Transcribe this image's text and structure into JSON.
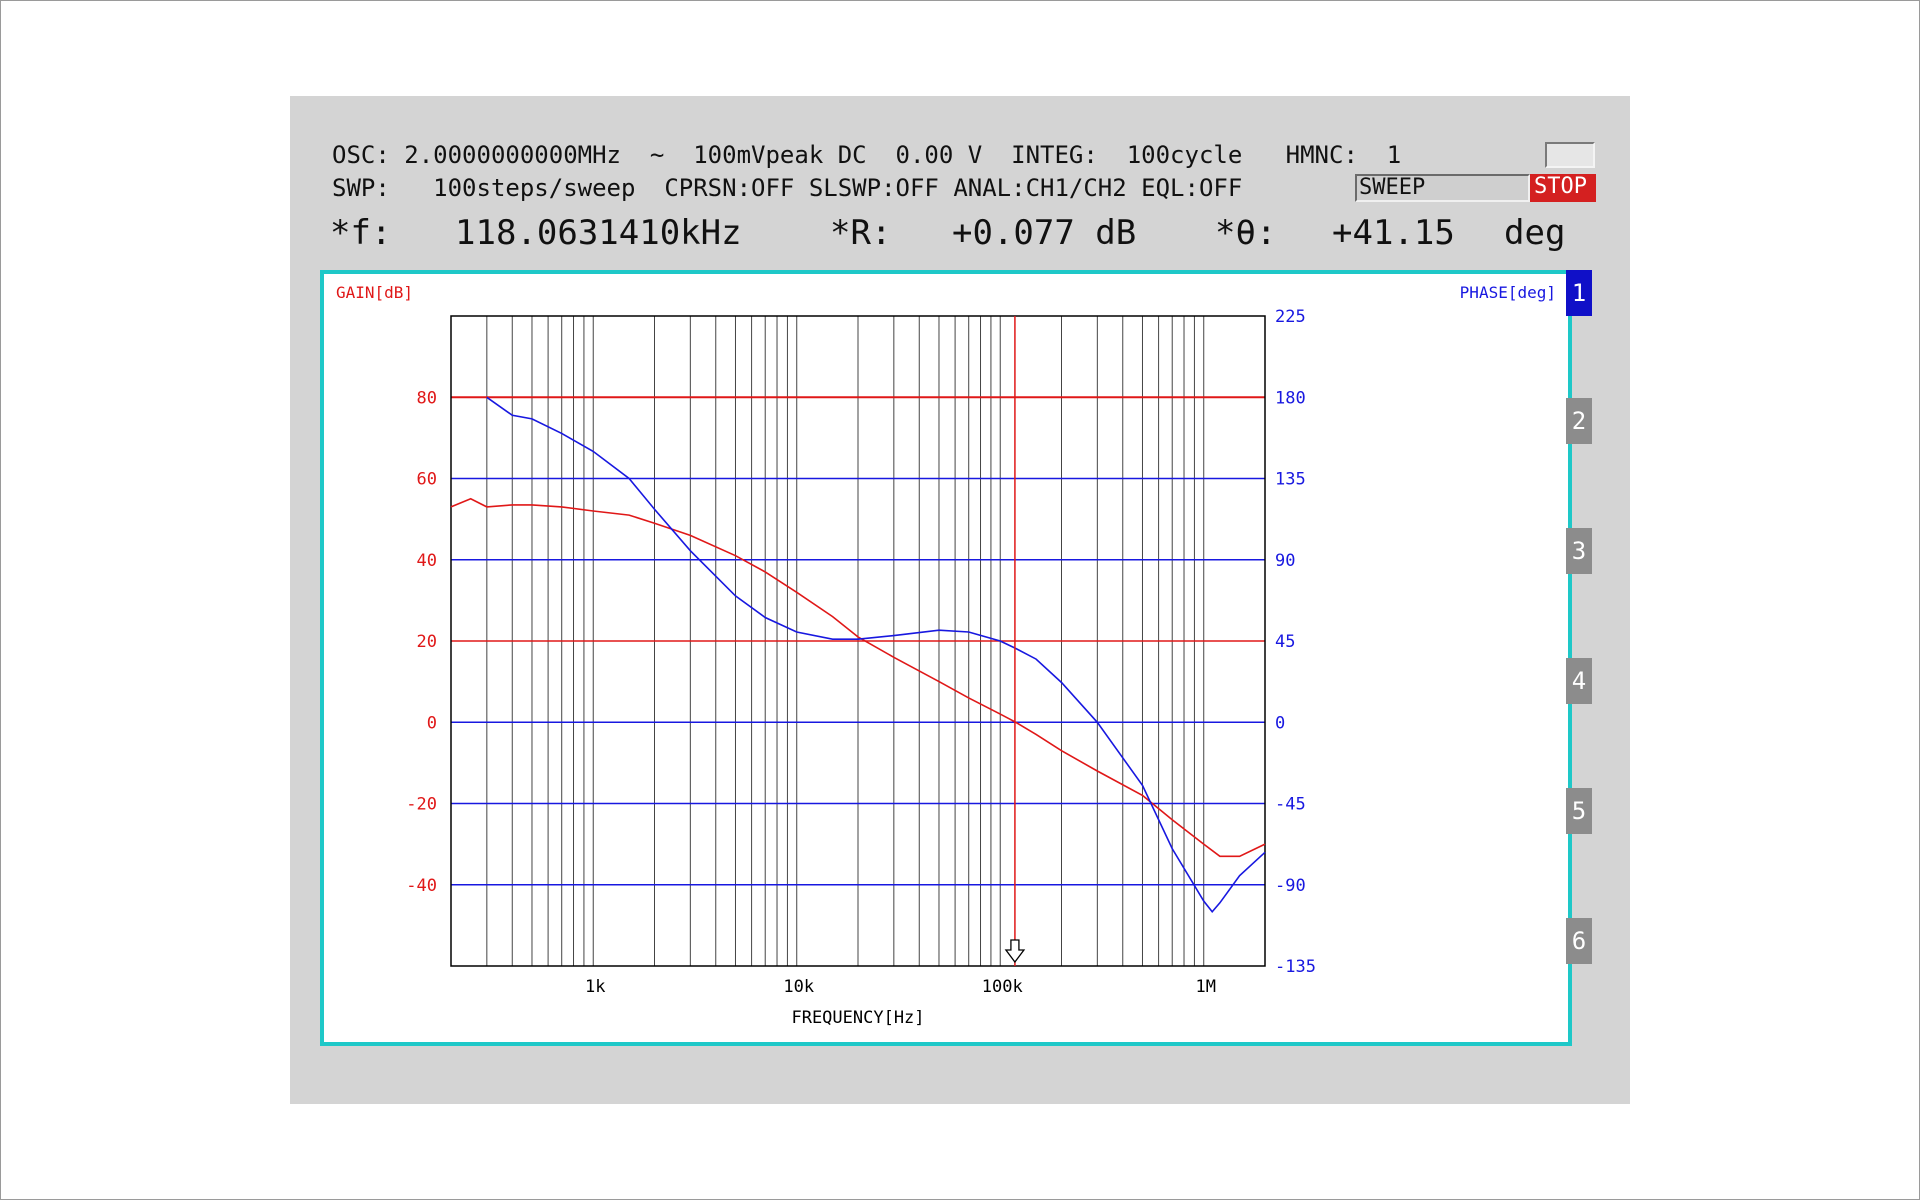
{
  "status": {
    "line1": "OSC: 2.0000000000MHz  ~  100mVpeak DC  0.00 V  INTEG:  100cycle   HMNC:  1",
    "line2": "SWP:   100steps/sweep  CPRSN:OFF SLSWP:OFF ANAL:CH1/CH2 EQL:OFF",
    "sweep_label": "SWEEP",
    "stop_label": "STOP"
  },
  "readout": {
    "freq_label": "*f:",
    "freq_value": "118.0631410kHz",
    "r_label": "*R:",
    "r_value": "+0.077 dB",
    "theta_label": "*θ:",
    "theta_value": "+41.15",
    "theta_unit": "deg"
  },
  "side_buttons": [
    "1",
    "2",
    "3",
    "4",
    "5",
    "6"
  ],
  "colors": {
    "gain": "#e01818",
    "phase": "#1818e0",
    "frame": "#1ec8c8",
    "grid_vertical": "#444444"
  },
  "chart_data": {
    "type": "line",
    "xlabel": "FREQUENCY[Hz]",
    "y1label": "GAIN[dB]",
    "y2label": "PHASE[deg]",
    "x_scale": "log",
    "xlim": [
      200,
      2000000
    ],
    "y1lim": [
      -60,
      100
    ],
    "y2lim": [
      -135,
      225
    ],
    "x_ticks": [
      {
        "value": 1000,
        "label": "1k"
      },
      {
        "value": 10000,
        "label": "10k"
      },
      {
        "value": 100000,
        "label": "100k"
      },
      {
        "value": 1000000,
        "label": "1M"
      }
    ],
    "y1_ticks": [
      80,
      60,
      40,
      20,
      0,
      -20,
      -40
    ],
    "y2_ticks": [
      225,
      180,
      135,
      90,
      45,
      0,
      -45,
      -90,
      -135
    ],
    "cursor_frequency": 118063.141,
    "series": [
      {
        "axis": "left",
        "x": [
          200,
          250,
          300,
          400,
          500,
          700,
          1000,
          1500,
          2000,
          3000,
          5000,
          7000,
          10000,
          15000,
          20000,
          30000,
          50000,
          70000,
          100000,
          118063,
          150000,
          200000,
          300000,
          500000,
          700000,
          1000000,
          1200000,
          1500000,
          2000000
        ],
        "values": [
          53,
          55,
          53,
          53.5,
          53.5,
          53,
          52,
          51,
          49,
          46,
          41,
          37,
          32,
          26,
          21,
          16,
          10,
          6,
          2,
          0.1,
          -3,
          -7,
          -12,
          -18,
          -24,
          -30,
          -33,
          -33,
          -30
        ]
      },
      {
        "axis": "right",
        "x": [
          300,
          400,
          500,
          700,
          1000,
          1500,
          2000,
          3000,
          5000,
          7000,
          10000,
          15000,
          20000,
          30000,
          50000,
          70000,
          100000,
          118063,
          150000,
          200000,
          300000,
          500000,
          700000,
          1000000,
          1100000,
          1200000,
          1500000,
          2000000
        ],
        "values": [
          180,
          170,
          168,
          160,
          150,
          135,
          118,
          95,
          70,
          58,
          50,
          46,
          46,
          48,
          51,
          50,
          45,
          41.15,
          35,
          22,
          0,
          -35,
          -70,
          -99,
          -105,
          -100,
          -85,
          -72
        ]
      }
    ]
  }
}
